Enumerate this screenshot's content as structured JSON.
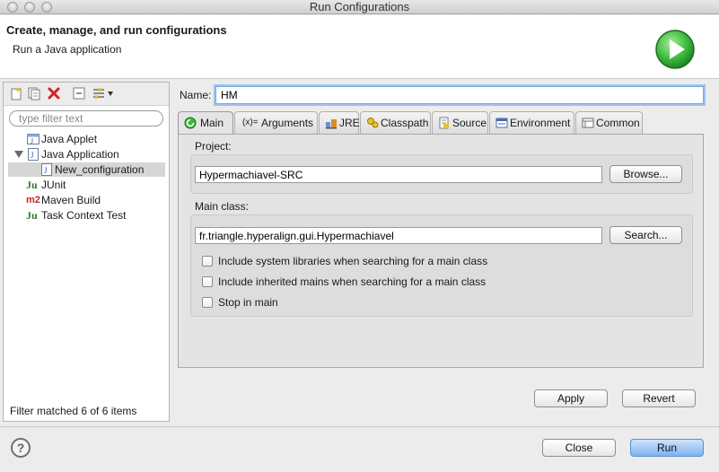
{
  "window": {
    "title": "Run Configurations"
  },
  "header": {
    "title": "Create, manage, and run configurations",
    "subtitle": "Run a Java application"
  },
  "sidebar": {
    "filter_placeholder": "type filter text",
    "items": [
      {
        "label": "Java Applet",
        "icon": "java-applet-icon"
      },
      {
        "label": "Java Application",
        "icon": "java-application-icon",
        "expanded": true
      },
      {
        "label": "New_configuration",
        "icon": "java-config-icon",
        "selected": true
      },
      {
        "label": "JUnit",
        "icon": "junit-icon"
      },
      {
        "label": "Maven Build",
        "icon": "maven-m2-icon"
      },
      {
        "label": "Task Context Test",
        "icon": "task-context-test-icon"
      }
    ],
    "status": "Filter matched 6 of 6 items",
    "maven_badge": "m2",
    "junit_badge": "Ju"
  },
  "config": {
    "name_label": "Name:",
    "name_value": "HM",
    "tabs": [
      {
        "label": "Main",
        "icon": "main-tab-icon",
        "active": true
      },
      {
        "label": "Arguments",
        "icon": "arguments-icon",
        "glyph": "(x)="
      },
      {
        "label": "JRE",
        "icon": "jre-icon"
      },
      {
        "label": "Classpath",
        "icon": "classpath-icon"
      },
      {
        "label": "Source",
        "icon": "source-icon"
      },
      {
        "label": "Environment",
        "icon": "environment-icon"
      },
      {
        "label": "Common",
        "icon": "common-icon"
      }
    ],
    "project_label": "Project:",
    "project_value": "Hypermachiavel-SRC",
    "browse_label": "Browse...",
    "main_class_label": "Main class:",
    "main_class_value": "fr.triangle.hyperalign.gui.Hypermachiavel",
    "search_label": "Search...",
    "options": [
      {
        "label": "Include system libraries when searching for a main class",
        "checked": false
      },
      {
        "label": "Include inherited mains when searching for a main class",
        "checked": false
      },
      {
        "label": "Stop in main",
        "checked": false
      }
    ],
    "apply_label": "Apply",
    "revert_label": "Revert"
  },
  "footer": {
    "help_glyph": "?",
    "close_label": "Close",
    "run_label": "Run"
  },
  "colors": {
    "run_green": "#3cb83c",
    "selection": "#d6d6d6",
    "focus_blue": "#7aa7e0",
    "default_button": "#7fb2ef"
  }
}
